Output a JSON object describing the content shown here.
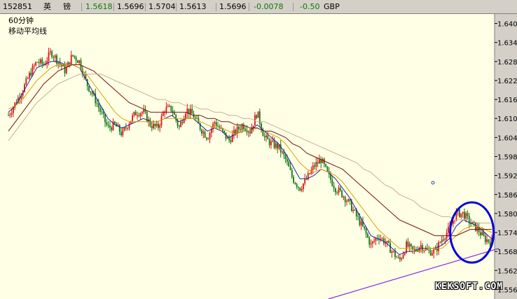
{
  "header": {
    "code": "152851",
    "name_1": "英",
    "name_2": "镑",
    "quote_1": "1.5618",
    "quote_2": "1.5696",
    "quote_3": "1.5704",
    "quote_4": "1.5613",
    "quote_5": "1.5696",
    "change": "-0.0078",
    "change_pct": "-0.50",
    "currency": "GBP"
  },
  "chart_labels": {
    "period": "60分钟",
    "indicator": "移动平均线"
  },
  "watermark": "KEKSOFT.COM",
  "colors": {
    "plot_bg": "#ffffe6",
    "up": "#dd1111",
    "down": "#117711",
    "ma_short": "#2222aa",
    "ma_mid": "#e0a000",
    "ma_long": "#7a1010",
    "ma_longest": "#c8b090",
    "trendline": "#8a2be2",
    "circle": "#0000dd"
  },
  "chart_data": {
    "type": "line",
    "title": "",
    "xlabel": "",
    "ylabel": "",
    "ylim": [
      1.553,
      1.643
    ],
    "yticks": [
      "1.640",
      "1.634",
      "1.628",
      "1.622",
      "1.616",
      "1.610",
      "1.604",
      "1.598",
      "1.592",
      "1.586",
      "1.580",
      "1.574",
      "1.568",
      "1.562",
      "1.556"
    ],
    "grid": false,
    "x": [
      0,
      10,
      20,
      30,
      40,
      50,
      60,
      70,
      80,
      90,
      100,
      110,
      120,
      130,
      140,
      150,
      160,
      170,
      180,
      190,
      200,
      210,
      220,
      230,
      240,
      250,
      260,
      270,
      280,
      290,
      300,
      310,
      320,
      330,
      340,
      350,
      360,
      370,
      380,
      390,
      400,
      410,
      420,
      430,
      440,
      450,
      460,
      470,
      480,
      490,
      500,
      510,
      520,
      530,
      540,
      550,
      560,
      570,
      580,
      590,
      600,
      610,
      620,
      630,
      640,
      650,
      660,
      670,
      680
    ],
    "series": [
      {
        "name": "",
        "role": "price",
        "values": [
          1.611,
          1.615,
          1.619,
          1.624,
          1.628,
          1.627,
          1.631,
          1.628,
          1.625,
          1.63,
          1.628,
          1.621,
          1.617,
          1.612,
          1.607,
          1.608,
          1.605,
          1.609,
          1.612,
          1.612,
          1.608,
          1.607,
          1.613,
          1.613,
          1.607,
          1.613,
          1.611,
          1.607,
          1.604,
          1.609,
          1.606,
          1.603,
          1.606,
          1.608,
          1.606,
          1.612,
          1.604,
          1.602,
          1.601,
          1.597,
          1.591,
          1.588,
          1.591,
          1.595,
          1.597,
          1.592,
          1.588,
          1.586,
          1.583,
          1.579,
          1.575,
          1.57,
          1.573,
          1.571,
          1.568,
          1.565,
          1.57,
          1.568,
          1.57,
          1.568,
          1.568,
          1.572,
          1.575,
          1.58,
          1.58,
          1.577,
          1.575,
          1.572,
          1.571
        ]
      },
      {
        "name": "",
        "role": "ma_short",
        "values": [
          1.612,
          1.614,
          1.618,
          1.622,
          1.626,
          1.627,
          1.628,
          1.628,
          1.627,
          1.627,
          1.626,
          1.622,
          1.618,
          1.614,
          1.61,
          1.608,
          1.607,
          1.608,
          1.609,
          1.61,
          1.609,
          1.609,
          1.61,
          1.611,
          1.609,
          1.61,
          1.61,
          1.608,
          1.606,
          1.607,
          1.606,
          1.604,
          1.605,
          1.606,
          1.606,
          1.608,
          1.606,
          1.604,
          1.602,
          1.599,
          1.595,
          1.591,
          1.591,
          1.592,
          1.594,
          1.593,
          1.591,
          1.588,
          1.585,
          1.581,
          1.577,
          1.573,
          1.572,
          1.571,
          1.569,
          1.567,
          1.568,
          1.568,
          1.569,
          1.569,
          1.569,
          1.57,
          1.572,
          1.576,
          1.578,
          1.577,
          1.576,
          1.574,
          1.572
        ]
      },
      {
        "name": "",
        "role": "ma_mid",
        "values": [
          1.613,
          1.614,
          1.616,
          1.619,
          1.622,
          1.624,
          1.626,
          1.627,
          1.627,
          1.627,
          1.626,
          1.624,
          1.621,
          1.618,
          1.615,
          1.612,
          1.61,
          1.609,
          1.609,
          1.609,
          1.609,
          1.609,
          1.61,
          1.61,
          1.61,
          1.61,
          1.61,
          1.609,
          1.608,
          1.607,
          1.607,
          1.606,
          1.605,
          1.606,
          1.606,
          1.607,
          1.606,
          1.605,
          1.604,
          1.602,
          1.599,
          1.596,
          1.594,
          1.593,
          1.594,
          1.593,
          1.592,
          1.59,
          1.587,
          1.584,
          1.581,
          1.578,
          1.575,
          1.573,
          1.571,
          1.569,
          1.569,
          1.568,
          1.568,
          1.569,
          1.569,
          1.569,
          1.571,
          1.573,
          1.575,
          1.576,
          1.576,
          1.575,
          1.574
        ]
      },
      {
        "name": "",
        "role": "ma_long",
        "values": [
          1.606,
          1.609,
          1.612,
          1.615,
          1.618,
          1.621,
          1.623,
          1.625,
          1.626,
          1.627,
          1.627,
          1.626,
          1.625,
          1.623,
          1.621,
          1.619,
          1.617,
          1.615,
          1.614,
          1.613,
          1.612,
          1.612,
          1.612,
          1.612,
          1.612,
          1.612,
          1.611,
          1.611,
          1.61,
          1.61,
          1.609,
          1.609,
          1.608,
          1.608,
          1.607,
          1.607,
          1.606,
          1.606,
          1.605,
          1.604,
          1.602,
          1.601,
          1.599,
          1.598,
          1.597,
          1.596,
          1.595,
          1.594,
          1.592,
          1.59,
          1.588,
          1.586,
          1.584,
          1.582,
          1.58,
          1.578,
          1.577,
          1.576,
          1.575,
          1.574,
          1.573,
          1.573,
          1.573,
          1.573,
          1.574,
          1.575,
          1.575,
          1.575,
          1.575
        ]
      },
      {
        "name": "",
        "role": "ma_longest",
        "values": [
          1.603,
          1.606,
          1.609,
          1.612,
          1.615,
          1.617,
          1.619,
          1.621,
          1.622,
          1.623,
          1.624,
          1.624,
          1.624,
          1.624,
          1.623,
          1.622,
          1.621,
          1.62,
          1.619,
          1.618,
          1.617,
          1.616,
          1.616,
          1.615,
          1.615,
          1.614,
          1.614,
          1.613,
          1.613,
          1.612,
          1.612,
          1.611,
          1.611,
          1.61,
          1.61,
          1.609,
          1.609,
          1.608,
          1.607,
          1.606,
          1.605,
          1.604,
          1.603,
          1.602,
          1.601,
          1.6,
          1.599,
          1.598,
          1.597,
          1.596,
          1.594,
          1.593,
          1.591,
          1.589,
          1.588,
          1.586,
          1.585,
          1.584,
          1.582,
          1.581,
          1.58,
          1.579,
          1.579,
          1.578,
          1.578,
          1.578,
          1.577,
          1.577,
          1.577
        ]
      }
    ],
    "trendline": {
      "x": [
        450,
        690
      ],
      "y": [
        1.553,
        1.569
      ]
    },
    "annotation_circle": {
      "x": 652,
      "y": 1.574
    }
  }
}
